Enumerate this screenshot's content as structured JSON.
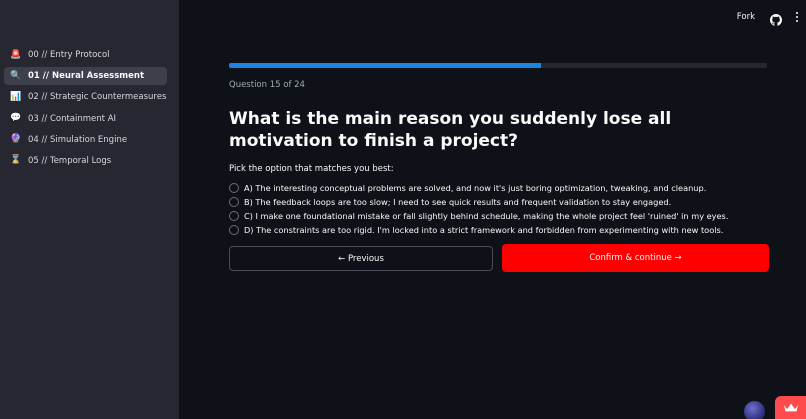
{
  "sidebar": {
    "items": [
      {
        "icon": "🚨",
        "icon_name": "siren-icon",
        "label": "00 // Entry Protocol"
      },
      {
        "icon": "🔍",
        "icon_name": "magnifier-icon",
        "label": "01 // Neural Assessment"
      },
      {
        "icon": "📊",
        "icon_name": "bar-chart-icon",
        "label": "02 // Strategic Countermeasures"
      },
      {
        "icon": "💬",
        "icon_name": "speech-bubble-icon",
        "label": "03 // Containment AI"
      },
      {
        "icon": "🔮",
        "icon_name": "crystal-ball-icon",
        "label": "04 // Simulation Engine"
      },
      {
        "icon": "⌛",
        "icon_name": "hourglass-icon",
        "label": "05 // Temporal Logs"
      }
    ],
    "active_index": 1
  },
  "topbar": {
    "fork_label": "Fork"
  },
  "quiz": {
    "progress": 0.58,
    "counter": "Question 15 of 24",
    "question": "What is the main reason you suddenly lose all motivation to finish a project?",
    "prompt": "Pick the option that matches you best:",
    "options": [
      "A) The interesting conceptual problems are solved, and now it's just boring optimization, tweaking, and cleanup.",
      "B) The feedback loops are too slow; I need to see quick results and frequent validation to stay engaged.",
      "C) I make one foundational mistake or fall slightly behind schedule, making the whole project feel 'ruined' in my eyes.",
      "D) The constraints are too rigid. I'm locked into a strict framework and forbidden from experimenting with new tools."
    ],
    "prev_label": "← Previous",
    "next_label": "Confirm & continue →"
  },
  "colors": {
    "accent_blue": "#1c83e1",
    "primary_red": "#ff0000",
    "sidebar_bg": "#262730",
    "page_bg": "#0e1117"
  }
}
